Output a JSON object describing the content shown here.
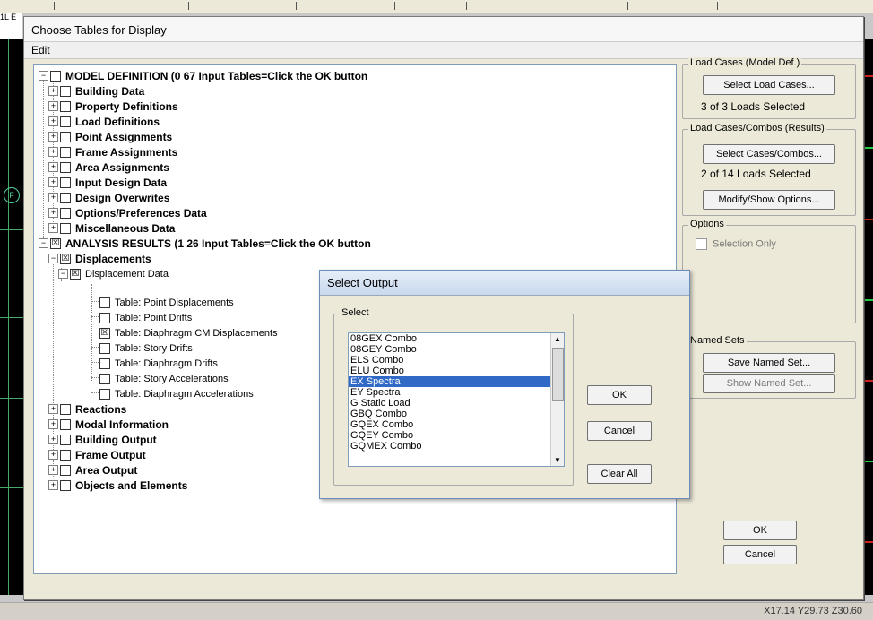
{
  "background": {
    "corner_text": "1L\nE",
    "grid_marker": "F",
    "coordinates": "X17.14  Y29.73  Z30.60"
  },
  "dialog": {
    "title": "Choose Tables for Display",
    "menu": [
      "Edit"
    ],
    "tree": {
      "model_definition": "MODEL DEFINITION  (0  67 Input Tables=Click the OK button",
      "model_children": [
        "Building Data",
        "Property Definitions",
        "Load Definitions",
        "Point Assignments",
        "Frame Assignments",
        "Area Assignments",
        "Input Design Data",
        "Design Overwrites",
        "Options/Preferences Data",
        "Miscellaneous Data"
      ],
      "analysis_results": "ANALYSIS RESULTS  (1  26 Input Tables=Click the OK button",
      "displacements": "Displacements",
      "displacement_data": "Displacement Data",
      "tables": [
        "Table:  Point Displacements",
        "Table:  Point Drifts",
        "Table:  Diaphragm CM Displacements",
        "Table:  Story Drifts",
        "Table:  Diaphragm Drifts",
        "Table:  Story Accelerations",
        "Table:  Diaphragm Accelerations"
      ],
      "tables_checked": [
        false,
        false,
        true,
        false,
        false,
        false,
        false
      ],
      "analysis_children": [
        "Reactions",
        "Modal Information",
        "Building Output",
        "Frame Output",
        "Area Output",
        "Objects and Elements"
      ]
    },
    "load_cases": {
      "title": "Load Cases (Model Def.)",
      "button": "Select Load Cases...",
      "info": "3  of  3  Loads Selected"
    },
    "load_combos": {
      "title": "Load Cases/Combos (Results)",
      "button": "Select Cases/Combos...",
      "info": "2  of  14  Loads Selected",
      "modify_button": "Modify/Show Options..."
    },
    "options": {
      "title": "Options",
      "selection_only": "Selection Only"
    },
    "named_sets": {
      "title": "Named Sets",
      "save_button": "Save Named Set...",
      "show_button": "Show Named Set..."
    },
    "ok_button": "OK",
    "cancel_button": "Cancel"
  },
  "popup": {
    "title": "Select Output",
    "group_title": "Select",
    "items": [
      "08GEX Combo",
      "08GEY Combo",
      "ELS Combo",
      "ELU Combo",
      "EX Spectra",
      "EY Spectra",
      "G Static Load",
      "GBQ Combo",
      "GQEX Combo",
      "GQEY Combo",
      "GQMEX Combo"
    ],
    "selected_index": 4,
    "ok_button": "OK",
    "cancel_button": "Cancel",
    "clear_button": "Clear All"
  }
}
